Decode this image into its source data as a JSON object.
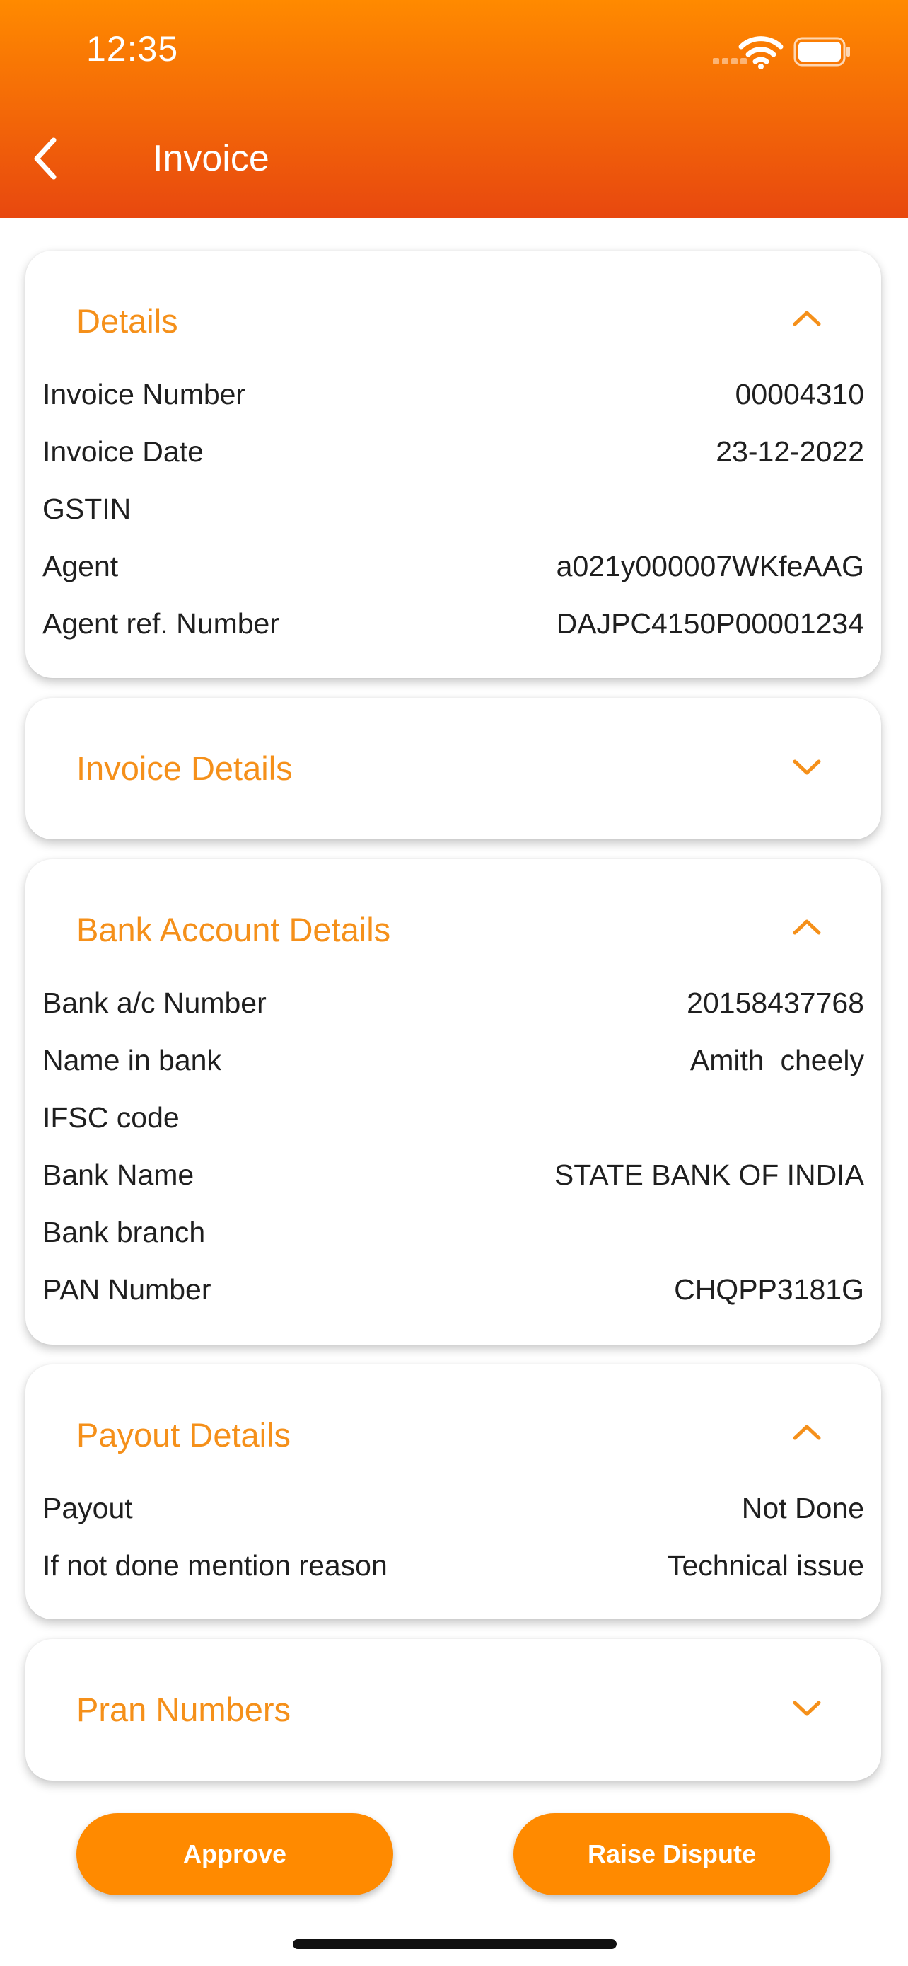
{
  "status_bar": {
    "time": "12:35"
  },
  "header": {
    "title": "Invoice"
  },
  "details": {
    "title": "Details",
    "rows": [
      {
        "label": "Invoice Number",
        "value": "00004310"
      },
      {
        "label": "Invoice Date",
        "value": "23-12-2022"
      },
      {
        "label": "GSTIN",
        "value": ""
      },
      {
        "label": "Agent",
        "value": "a021y000007WKfeAAG"
      },
      {
        "label": "Agent ref. Number",
        "value": "DAJPC4150P00001234"
      }
    ]
  },
  "invoice_details": {
    "title": "Invoice Details"
  },
  "bank": {
    "title": "Bank Account Details",
    "rows": [
      {
        "label": "Bank a/c Number",
        "value": "20158437768"
      },
      {
        "label": "Name in bank",
        "value": "Amith  cheely"
      },
      {
        "label": "IFSC code",
        "value": ""
      },
      {
        "label": "Bank Name",
        "value": "STATE BANK OF INDIA"
      },
      {
        "label": "Bank branch",
        "value": ""
      },
      {
        "label": "PAN Number",
        "value": "CHQPP3181G"
      }
    ]
  },
  "payout": {
    "title": "Payout Details",
    "rows": [
      {
        "label": "Payout",
        "value": "Not Done"
      },
      {
        "label": "If not done mention reason",
        "value": "Technical issue"
      }
    ]
  },
  "pran": {
    "title": "Pran Numbers"
  },
  "actions": {
    "approve": "Approve",
    "dispute": "Raise Dispute"
  },
  "colors": {
    "accent": "#ff8a00",
    "header_bottom": "#e8480f",
    "section_title": "#f5901a"
  }
}
